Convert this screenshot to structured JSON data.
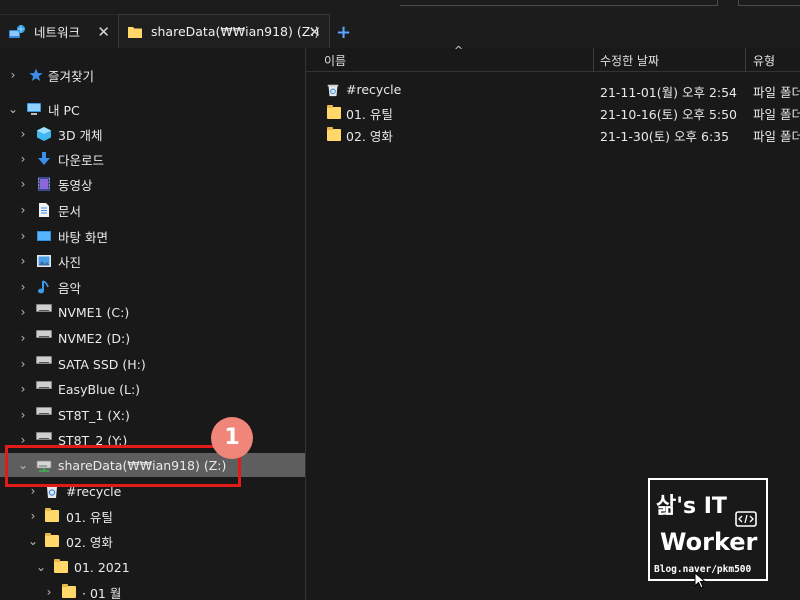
{
  "tabs": [
    {
      "label": "네트워크",
      "icon": "network-icon",
      "active": false
    },
    {
      "label": "shareData(₩₩ian918) (Z:)",
      "icon": "folder-icon",
      "active": true
    }
  ],
  "tab_close_glyph": "✕",
  "new_tab_glyph": "+",
  "nav": {
    "items": [
      {
        "label": "즐겨찾기",
        "icon": "star-icon",
        "expanded": false
      },
      {
        "label": "내 PC",
        "icon": "pc-icon",
        "expanded": true
      },
      {
        "label": "3D 개체",
        "icon": "3d-objects-icon"
      },
      {
        "label": "다운로드",
        "icon": "download-icon"
      },
      {
        "label": "동영상",
        "icon": "video-icon"
      },
      {
        "label": "문서",
        "icon": "document-icon"
      },
      {
        "label": "바탕 화면",
        "icon": "desktop-icon"
      },
      {
        "label": "사진",
        "icon": "pictures-icon"
      },
      {
        "label": "음악",
        "icon": "music-icon"
      },
      {
        "label": "NVME1 (C:)",
        "icon": "drive-icon"
      },
      {
        "label": "NVME2 (D:)",
        "icon": "drive-icon"
      },
      {
        "label": "SATA SSD (H:)",
        "icon": "drive-icon"
      },
      {
        "label": "EasyBlue (L:)",
        "icon": "drive-icon"
      },
      {
        "label": "ST8T_1 (X:)",
        "icon": "drive-icon"
      },
      {
        "label": "ST8T_2 (Y:)",
        "icon": "drive-icon"
      },
      {
        "label": "shareData(₩₩ian918) (Z:)",
        "icon": "network-drive-icon",
        "selected": true
      },
      {
        "label": "#recycle",
        "icon": "recycle-bin-icon"
      },
      {
        "label": "01. 유틸",
        "icon": "folder-icon"
      },
      {
        "label": "02. 영화",
        "icon": "folder-icon"
      },
      {
        "label": "01. 2021",
        "icon": "folder-icon"
      },
      {
        "label": "· 01 월",
        "icon": "folder-icon"
      }
    ]
  },
  "columns": {
    "name": "이름",
    "modified": "수정한 날짜",
    "type": "유형"
  },
  "files": [
    {
      "name": "#recycle",
      "icon": "recycle-bin-icon",
      "modified": "21-11-01(월) 오후 2:54",
      "type": "파일 폴더"
    },
    {
      "name": "01. 유틸",
      "icon": "folder-icon",
      "modified": "21-10-16(토) 오후 5:50",
      "type": "파일 폴더"
    },
    {
      "name": "02. 영화",
      "icon": "folder-icon",
      "modified": "21-1-30(토) 오후 6:35",
      "type": "파일 폴더"
    }
  ],
  "annotation": {
    "badge": "1",
    "color": "#e21a1a"
  },
  "watermark": {
    "line1": "삶's IT",
    "line2": "Worker",
    "line3": "Blog.naver/pkm500"
  },
  "colors": {
    "background": "#191919",
    "selected_row": "#5e5e5e",
    "folder": "#ffd869",
    "accent": "#5aa3ff"
  }
}
